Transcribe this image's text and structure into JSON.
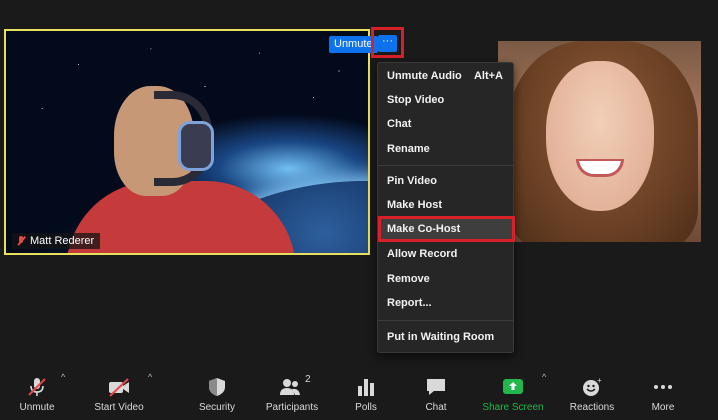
{
  "participants": {
    "main": {
      "name": "Matt Rederer",
      "unmute_label": "Unmute",
      "more_label": "···"
    },
    "second": {}
  },
  "context_menu": {
    "items": [
      {
        "label": "Unmute Audio",
        "shortcut": "Alt+A"
      },
      {
        "label": "Stop Video",
        "shortcut": ""
      },
      {
        "label": "Chat",
        "shortcut": ""
      },
      {
        "label": "Rename",
        "shortcut": ""
      },
      {
        "label": "Pin Video",
        "shortcut": ""
      },
      {
        "label": "Make Host",
        "shortcut": ""
      },
      {
        "label": "Make Co-Host",
        "shortcut": ""
      },
      {
        "label": "Allow Record",
        "shortcut": ""
      },
      {
        "label": "Remove",
        "shortcut": ""
      },
      {
        "label": "Report...",
        "shortcut": ""
      },
      {
        "label": "Put in Waiting Room",
        "shortcut": ""
      }
    ],
    "highlighted": "Make Co-Host"
  },
  "toolbar": {
    "unmute": "Unmute",
    "start_video": "Start Video",
    "security": "Security",
    "participants": "Participants",
    "participants_count": "2",
    "polls": "Polls",
    "chat": "Chat",
    "share_screen": "Share Screen",
    "reactions": "Reactions",
    "more": "More"
  },
  "colors": {
    "accent": "#0e72ed",
    "highlight_box": "#d8202a",
    "speaker_border": "#e6e05a",
    "share_green": "#21b74b",
    "muted_red": "#e54848"
  }
}
